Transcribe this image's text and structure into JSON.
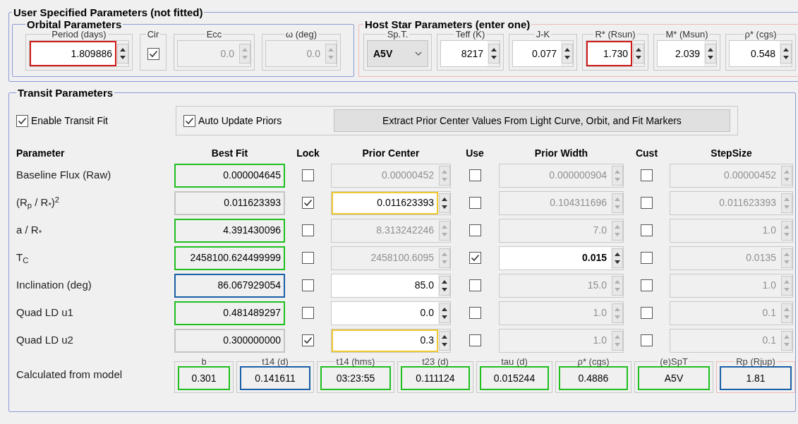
{
  "user_specified": {
    "title": "User Specified Parameters (not fitted)",
    "orbital": {
      "title": "Orbital Parameters",
      "fields": [
        {
          "kind": "spin",
          "label": "Period (days)",
          "value": "1.809886",
          "color": "#d01818",
          "disabled": false
        },
        {
          "kind": "check",
          "label": "Cir",
          "checked": true
        },
        {
          "kind": "spin",
          "label": "Ecc",
          "value": "0.0",
          "disabled": true
        },
        {
          "kind": "spin",
          "label": "ω (deg)",
          "value": "0.0",
          "disabled": true
        }
      ]
    },
    "host_star": {
      "title": "Host Star Parameters (enter one)",
      "fields": [
        {
          "kind": "combo",
          "label": "Sp.T.",
          "value": "A5V"
        },
        {
          "kind": "spin",
          "label": "Teff (K)",
          "value": "8217",
          "disabled": false
        },
        {
          "kind": "spin",
          "label": "J-K",
          "value": "0.077",
          "disabled": false
        },
        {
          "kind": "spin",
          "label": "R* (Rsun)",
          "value": "1.730",
          "color": "#d01818",
          "disabled": false
        },
        {
          "kind": "spin",
          "label": "M* (Msun)",
          "value": "2.039",
          "disabled": false
        },
        {
          "kind": "spin",
          "label": "ρ* (cgs)",
          "value": "0.548",
          "disabled": false
        }
      ]
    }
  },
  "transit": {
    "title": "Transit Parameters",
    "enable_fit": {
      "label": "Enable Transit Fit",
      "checked": true
    },
    "auto_update": {
      "label": "Auto Update Priors",
      "checked": true
    },
    "extract_button": "Extract Prior Center Values From Light Curve, Orbit, and Fit Markers",
    "columns": [
      "Parameter",
      "Best Fit",
      "Lock",
      "Prior Center",
      "Use",
      "Prior Width",
      "Cust",
      "StepSize"
    ],
    "rows": [
      {
        "parameter": "Baseline Flux (Raw)",
        "best_fit": {
          "value": "0.000004645",
          "color": "#1fbf1f"
        },
        "lock": false,
        "prior_center": {
          "value": "0.00000452",
          "disabled": true
        },
        "use": false,
        "prior_width": {
          "value": "0.000000904",
          "disabled": true
        },
        "cust": false,
        "step_size": {
          "value": "0.00000452",
          "disabled": true
        }
      },
      {
        "parameter": "(R$_{p}$ / R$_{*}$)$^{2}$",
        "best_fit": {
          "value": "0.011623393"
        },
        "lock": true,
        "prior_center": {
          "value": "0.011623393",
          "color": "#f0c830",
          "disabled": false
        },
        "use": false,
        "prior_width": {
          "value": "0.104311696",
          "disabled": true
        },
        "cust": false,
        "step_size": {
          "value": "0.011623393",
          "disabled": true
        }
      },
      {
        "parameter": "a / R$_{*}$",
        "best_fit": {
          "value": "4.391430096",
          "color": "#1fbf1f"
        },
        "lock": false,
        "prior_center": {
          "value": "8.313242246",
          "disabled": true
        },
        "use": false,
        "prior_width": {
          "value": "7.0",
          "disabled": true
        },
        "cust": false,
        "step_size": {
          "value": "1.0",
          "disabled": true
        }
      },
      {
        "parameter": "T$_{C}$",
        "best_fit": {
          "value": "2458100.624499999",
          "color": "#1fbf1f"
        },
        "lock": false,
        "prior_center": {
          "value": "2458100.6095",
          "disabled": true
        },
        "use": true,
        "prior_width": {
          "value": "0.015",
          "disabled": false
        },
        "cust": false,
        "step_size": {
          "value": "0.0135",
          "disabled": true
        }
      },
      {
        "parameter": "Inclination (deg)",
        "best_fit": {
          "value": "86.067929054",
          "color": "#1a5fa8"
        },
        "lock": false,
        "prior_center": {
          "value": "85.0",
          "disabled": false
        },
        "use": false,
        "prior_width": {
          "value": "15.0",
          "disabled": true
        },
        "cust": false,
        "step_size": {
          "value": "1.0",
          "disabled": true
        }
      },
      {
        "parameter": "Quad LD u1",
        "best_fit": {
          "value": "0.481489297",
          "color": "#1fbf1f"
        },
        "lock": false,
        "prior_center": {
          "value": "0.0",
          "disabled": false
        },
        "use": false,
        "prior_width": {
          "value": "1.0",
          "disabled": true
        },
        "cust": false,
        "step_size": {
          "value": "0.1",
          "disabled": true
        }
      },
      {
        "parameter": "Quad LD u2",
        "best_fit": {
          "value": "0.300000000"
        },
        "lock": true,
        "prior_center": {
          "value": "0.3",
          "color": "#f0c830",
          "disabled": false
        },
        "use": false,
        "prior_width": {
          "value": "1.0",
          "disabled": true
        },
        "cust": false,
        "step_size": {
          "value": "0.1",
          "disabled": true
        }
      }
    ],
    "calculated": {
      "label": "Calculated from model",
      "items": [
        {
          "label": "b",
          "value": "0.301",
          "color": "#1fbf1f",
          "flagged": false
        },
        {
          "label": "t14 (d)",
          "value": "0.141611",
          "color": "#1a5fa8",
          "flagged": false
        },
        {
          "label": "t14 (hms)",
          "value": "03:23:55",
          "color": "#1fbf1f",
          "flagged": false
        },
        {
          "label": "t23 (d)",
          "value": "0.111124",
          "color": "#1fbf1f",
          "flagged": false
        },
        {
          "label": "tau (d)",
          "value": "0.015244",
          "color": "#1fbf1f",
          "flagged": false
        },
        {
          "label": "ρ* (cgs)",
          "value": "0.4886",
          "color": "#1fbf1f",
          "flagged": false
        },
        {
          "label": "(e)SpT",
          "value": "A5V",
          "color": "#1fbf1f",
          "flagged": false
        },
        {
          "label": "Rp (Rjup)",
          "value": "1.81",
          "color": "#1a5fa8",
          "flagged": true
        }
      ]
    }
  }
}
